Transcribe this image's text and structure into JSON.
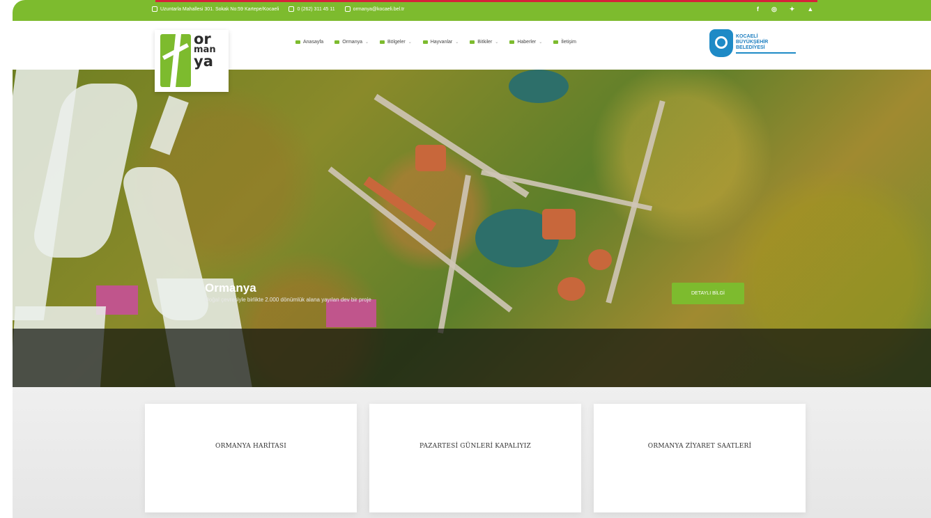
{
  "topbar": {
    "address": "Uzuntarla Mahallesi 301. Sokak No:59 Kartepe/Kocaeli",
    "phone": "0 (262) 311 45 11",
    "email": "ormanya@kocaeli.bel.tr",
    "social": [
      "f",
      "◎",
      "✦",
      "▲"
    ]
  },
  "logo": {
    "line1": "or",
    "line2": "man",
    "line3": "ya"
  },
  "nav": {
    "items": [
      {
        "label": "Anasayfa",
        "has_caret": false
      },
      {
        "label": "Ormanya",
        "has_caret": true
      },
      {
        "label": "Bölgeler",
        "has_caret": true
      },
      {
        "label": "Hayvanlar",
        "has_caret": true
      },
      {
        "label": "Bitkiler",
        "has_caret": true
      },
      {
        "label": "Haberler",
        "has_caret": true
      },
      {
        "label": "İletişim",
        "has_caret": false
      }
    ]
  },
  "partner": {
    "line1": "KOCAELİ",
    "line2": "BÜYÜKŞEHİR",
    "line3": "BELEDİYESİ"
  },
  "hero": {
    "title": "Ormanya",
    "subtitle": "Doğal çevresiyle birlikte 2.000 dönümlük alana yayılan dev bir proje",
    "button": "DETAYLI BİLGİ"
  },
  "cards": [
    {
      "label": "ORMANYA HARİTASI"
    },
    {
      "label": "PAZARTESİ GÜNLERİ KAPALIYIZ"
    },
    {
      "label": "ORMANYA ZİYARET SAATLERİ"
    }
  ],
  "colors": {
    "accent": "#7dbb2e",
    "top_line": "#d7213a",
    "partner_blue": "#1e8ac6"
  }
}
